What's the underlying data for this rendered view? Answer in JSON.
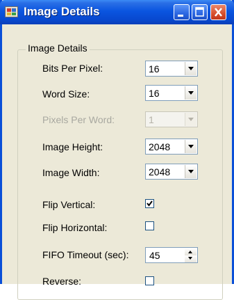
{
  "window": {
    "title": "Image Details"
  },
  "group": {
    "label": "Image Details"
  },
  "fields": {
    "bits_per_pixel": {
      "label": "Bits Per Pixel:",
      "value": "16"
    },
    "word_size": {
      "label": "Word Size:",
      "value": "16"
    },
    "pixels_per_word": {
      "label": "Pixels Per Word:",
      "value": "1",
      "disabled": true
    },
    "image_height": {
      "label": "Image Height:",
      "value": "2048"
    },
    "image_width": {
      "label": "Image Width:",
      "value": "2048"
    },
    "flip_vertical": {
      "label": "Flip Vertical:",
      "checked": true
    },
    "flip_horizontal": {
      "label": "Flip Horizontal:",
      "checked": false
    },
    "fifo_timeout": {
      "label": "FIFO Timeout (sec):",
      "value": "45"
    },
    "reverse": {
      "label": "Reverse:",
      "checked": false
    }
  },
  "icons": {
    "app": "image-details-app-icon",
    "minimize": "minimize-icon",
    "maximize": "maximize-icon",
    "close": "close-icon"
  },
  "colors": {
    "titlebar": "#0a55e0",
    "window_bg": "#ece9d8",
    "close_button": "#d8502d",
    "disabled_text": "#a8a8a0"
  }
}
